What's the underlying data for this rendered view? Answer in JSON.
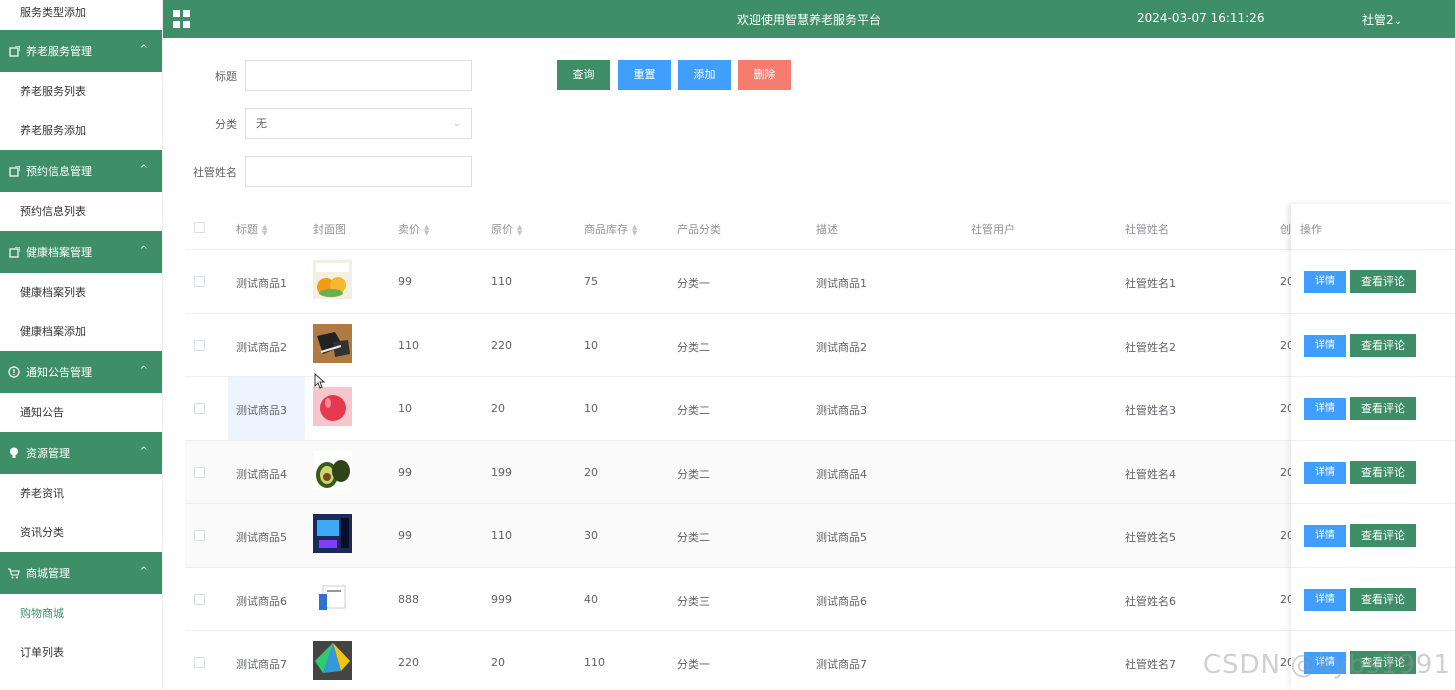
{
  "header": {
    "title": "欢迎使用智慧养老服务平台",
    "datetime": "2024-03-07 16:11:26",
    "user": "社管2",
    "user_caret": "⌄",
    "bg": "#3e8f68"
  },
  "sidebar": {
    "top_item": "服务类型添加",
    "groups": [
      {
        "label": "养老服务管理",
        "icon": "doc-icon",
        "items": [
          "养老服务列表",
          "养老服务添加"
        ]
      },
      {
        "label": "预约信息管理",
        "icon": "doc-icon",
        "items": [
          "预约信息列表"
        ]
      },
      {
        "label": "健康档案管理",
        "icon": "doc-icon",
        "items": [
          "健康档案列表",
          "健康档案添加"
        ]
      },
      {
        "label": "通知公告管理",
        "icon": "info-icon",
        "items": [
          "通知公告"
        ]
      },
      {
        "label": "资源管理",
        "icon": "bulb-icon",
        "items": [
          "养老资讯",
          "资讯分类"
        ]
      },
      {
        "label": "商城管理",
        "icon": "cart-icon",
        "items": [
          "购物商城",
          "订单列表"
        ]
      }
    ],
    "active": "购物商城",
    "chevron": "^"
  },
  "search": {
    "title_label": "标题",
    "title_value": "",
    "category_label": "分类",
    "category_value": "无",
    "manager_label": "社管姓名",
    "manager_value": "",
    "btn_query": "查询",
    "btn_reset": "重置",
    "btn_add": "添加",
    "btn_delete": "删除"
  },
  "table": {
    "headers": {
      "title": "标题",
      "cover": "封面图",
      "price": "卖价",
      "orig_price": "原价",
      "stock": "商品库存",
      "category": "产品分类",
      "desc": "描述",
      "user": "社管用户",
      "manager": "社管姓名",
      "created": "创",
      "ops": "操作"
    },
    "rows": [
      {
        "title": "测试商品1",
        "price": "99",
        "orig": "110",
        "stock": "75",
        "cat": "分类一",
        "desc": "测试商品1",
        "manager": "社管姓名1",
        "created": "20"
      },
      {
        "title": "测试商品2",
        "price": "110",
        "orig": "220",
        "stock": "10",
        "cat": "分类二",
        "desc": "测试商品2",
        "manager": "社管姓名2",
        "created": "20"
      },
      {
        "title": "测试商品3",
        "price": "10",
        "orig": "20",
        "stock": "10",
        "cat": "分类二",
        "desc": "测试商品3",
        "manager": "社管姓名3",
        "created": "20"
      },
      {
        "title": "测试商品4",
        "price": "99",
        "orig": "199",
        "stock": "20",
        "cat": "分类二",
        "desc": "测试商品4",
        "manager": "社管姓名4",
        "created": "20"
      },
      {
        "title": "测试商品5",
        "price": "99",
        "orig": "110",
        "stock": "30",
        "cat": "分类二",
        "desc": "测试商品5",
        "manager": "社管姓名5",
        "created": "20"
      },
      {
        "title": "测试商品6",
        "price": "888",
        "orig": "999",
        "stock": "40",
        "cat": "分类三",
        "desc": "测试商品6",
        "manager": "社管姓名6",
        "created": "20"
      },
      {
        "title": "测试商品7",
        "price": "220",
        "orig": "20",
        "stock": "110",
        "cat": "分类一",
        "desc": "测试商品7",
        "manager": "社管姓名7",
        "created": "20"
      }
    ],
    "btn_detail": "详情",
    "btn_comment": "查看评论"
  },
  "watermark": "CSDN @kybs1991"
}
